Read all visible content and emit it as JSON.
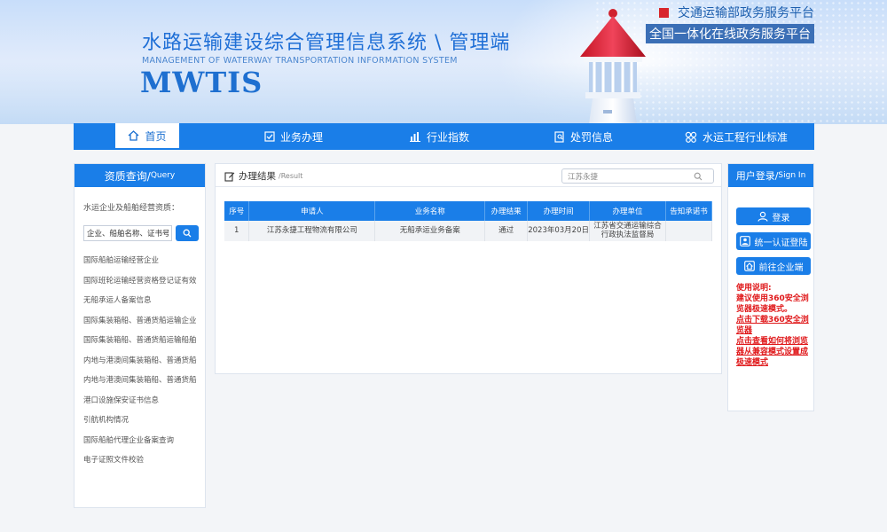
{
  "header": {
    "title": "水路运输建设综合管理信息系统 \\ 管理端",
    "subtitle_en": "MANAGEMENT OF WATERWAY TRANSPORTATION INFORMATION SYSTEM",
    "logo": "MWTIS",
    "portal_line1": "交通运输部政务服务平台",
    "portal_line2": "全国一体化在线政务服务平台"
  },
  "nav": {
    "items": [
      {
        "label": "首页",
        "icon": "home-icon"
      },
      {
        "label": "业务办理",
        "icon": "check-square-icon"
      },
      {
        "label": "行业指数",
        "icon": "bar-chart-icon"
      },
      {
        "label": "处罚信息",
        "icon": "document-search-icon"
      },
      {
        "label": "水运工程行业标准",
        "icon": "gear-cluster-icon"
      }
    ]
  },
  "left_panel": {
    "title": "资质查询/",
    "title_en": "Query",
    "query_label": "水运企业及船舶经营资质：",
    "search_value": "企业、船舶名称、证书号",
    "items": [
      "国际船舶运输经营企业",
      "国际班轮运输经营资格登记证有效",
      "无船承运人备案信息",
      "国际集装箱船、普通货船运输企业",
      "国际集装箱船、普通货船运输船舶",
      "内地与港澳间集装箱船、普通货船",
      "内地与港澳间集装箱船、普通货船",
      "港口设施保安证书信息",
      "引航机构情况",
      "国际船舶代理企业备案查询",
      "电子证照文件校验"
    ]
  },
  "result_panel": {
    "title": "办理结果",
    "title_en": "/Result",
    "search_value": "江苏永捷",
    "columns": [
      "序号",
      "申请人",
      "业务名称",
      "办理结果",
      "办理时间",
      "办理单位",
      "告知承诺书"
    ],
    "rows": [
      {
        "index": "1",
        "applicant": "江苏永捷工程物流有限公司",
        "business": "无船承运业务备案",
        "result": "通过",
        "date": "2023年03月20日",
        "unit": "江苏省交通运输综合行政执法监督局",
        "commitment": ""
      }
    ]
  },
  "right_panel": {
    "title": "用户登录/",
    "title_en": "Sign In",
    "login_button": "登录",
    "unified_button": "统一认证登陆",
    "enterprise_button": "前往企业端",
    "notes_title": "使用说明:",
    "notes_text": "建议使用360安全浏览器极速模式。",
    "download_link": "点击下载360安全浏览器",
    "howto_link": "点击查看如何将浏览器从兼容模式设置成极速模式"
  },
  "colors": {
    "primary": "#1a7ee8",
    "notice_red": "#e0191b",
    "portal_red": "#d8262b"
  }
}
